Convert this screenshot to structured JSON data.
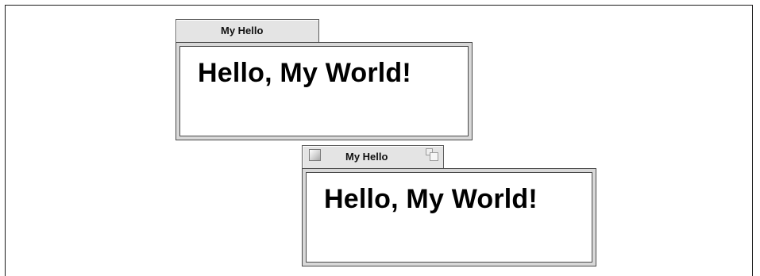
{
  "windows": [
    {
      "title": "My Hello",
      "message": "Hello, My World!",
      "active": false
    },
    {
      "title": "My Hello",
      "message": "Hello, My World!",
      "active": true,
      "close_icon": "close-box-icon",
      "zoom_icon": "zoom-box-icon"
    }
  ],
  "colors": {
    "tab_background": "#e4e4e4",
    "frame_background": "#d8d8d8",
    "content_background": "#ffffff",
    "text": "#000000"
  }
}
